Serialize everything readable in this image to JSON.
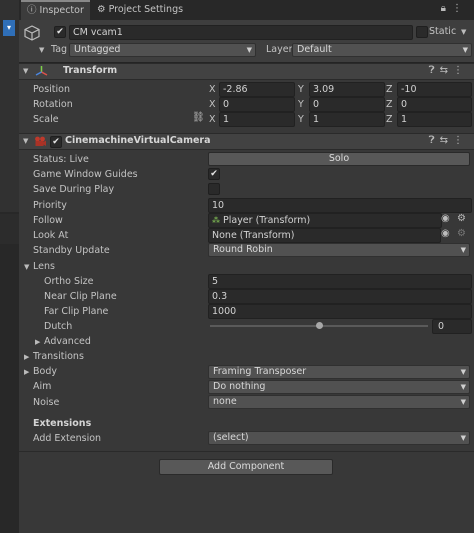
{
  "tabs": [
    {
      "label": "Inspector",
      "icon": "info-icon"
    },
    {
      "label": "Project Settings",
      "icon": "gear-icon"
    }
  ],
  "gameobject": {
    "name": "CM vcam1",
    "static_label": "Static",
    "tag_label": "Tag",
    "tag_value": "Untagged",
    "layer_label": "Layer",
    "layer_value": "Default"
  },
  "transform": {
    "title": "Transform",
    "rows": [
      {
        "label": "Position",
        "x": "-2.86",
        "y": "3.09",
        "z": "-10"
      },
      {
        "label": "Rotation",
        "x": "0",
        "y": "0",
        "z": "0"
      },
      {
        "label": "Scale",
        "x": "1",
        "y": "1",
        "z": "1"
      }
    ],
    "axis": {
      "x": "X",
      "y": "Y",
      "z": "Z"
    }
  },
  "vcam": {
    "title": "CinemachineVirtualCamera",
    "status": "Status: Live",
    "solo": "Solo",
    "game_window_guides": "Game Window Guides",
    "save_during_play": "Save During Play",
    "priority_label": "Priority",
    "priority_value": "10",
    "follow_label": "Follow",
    "follow_value": "Player (Transform)",
    "lookat_label": "Look At",
    "lookat_value": "None (Transform)",
    "standby_label": "Standby Update",
    "standby_value": "Round Robin",
    "lens_label": "Lens",
    "ortho_label": "Ortho Size",
    "ortho_value": "5",
    "near_label": "Near Clip Plane",
    "near_value": "0.3",
    "far_label": "Far Clip Plane",
    "far_value": "1000",
    "dutch_label": "Dutch",
    "dutch_value": "0",
    "dutch_level": 0.5,
    "advanced_label": "Advanced",
    "transitions_label": "Transitions",
    "body_label": "Body",
    "body_value": "Framing Transposer",
    "aim_label": "Aim",
    "aim_value": "Do nothing",
    "noise_label": "Noise",
    "noise_value": "none",
    "extensions_label": "Extensions",
    "add_extension_label": "Add Extension",
    "add_extension_value": "(select)"
  },
  "add_component": "Add Component"
}
